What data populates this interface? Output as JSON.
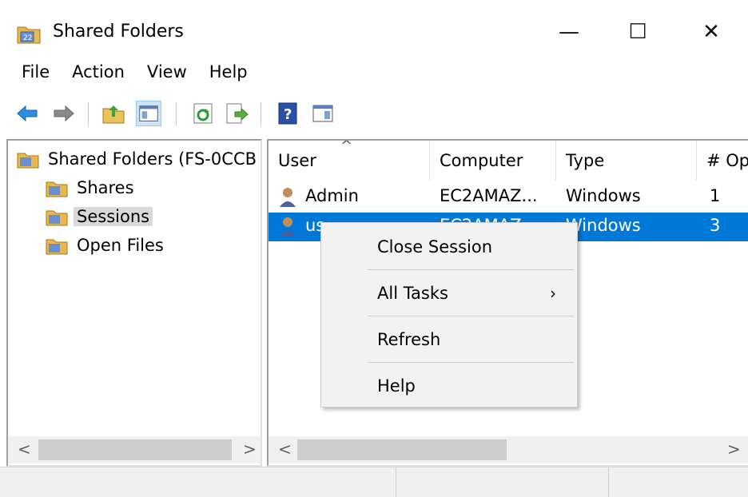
{
  "window": {
    "title": "Shared Folders",
    "min_glyph": "—",
    "max_glyph": "☐",
    "close_glyph": "✕",
    "icon": "shared-folders-icon"
  },
  "menu": [
    "File",
    "Action",
    "View",
    "Help"
  ],
  "toolbar": {
    "buttons": [
      "back-arrow-icon",
      "forward-arrow-icon",
      "up-folder-icon",
      "show-hide-console-tree-icon",
      "refresh-icon",
      "export-list-icon",
      "help-icon",
      "show-action-pane-icon"
    ]
  },
  "tree": {
    "root": "Shared Folders (FS-0CCB",
    "items": [
      "Shares",
      "Sessions",
      "Open Files"
    ],
    "selected": "Sessions"
  },
  "list": {
    "columns": [
      "User",
      "Computer",
      "Type",
      "# Op"
    ],
    "rows": [
      {
        "user": "Admin",
        "computer": "EC2AMAZ...",
        "type": "Windows",
        "open": "1"
      },
      {
        "user": "us",
        "computer": "EC2AMAZ...",
        "type": "Windows",
        "open": "3",
        "selected": true
      }
    ],
    "selected_color": "#0078d7"
  },
  "context_menu": {
    "items": [
      "Close Session",
      "All Tasks",
      "Refresh",
      "Help"
    ],
    "submenu_glyph": "›"
  },
  "scroll": {
    "left_glyph": "<",
    "right_glyph": ">"
  }
}
